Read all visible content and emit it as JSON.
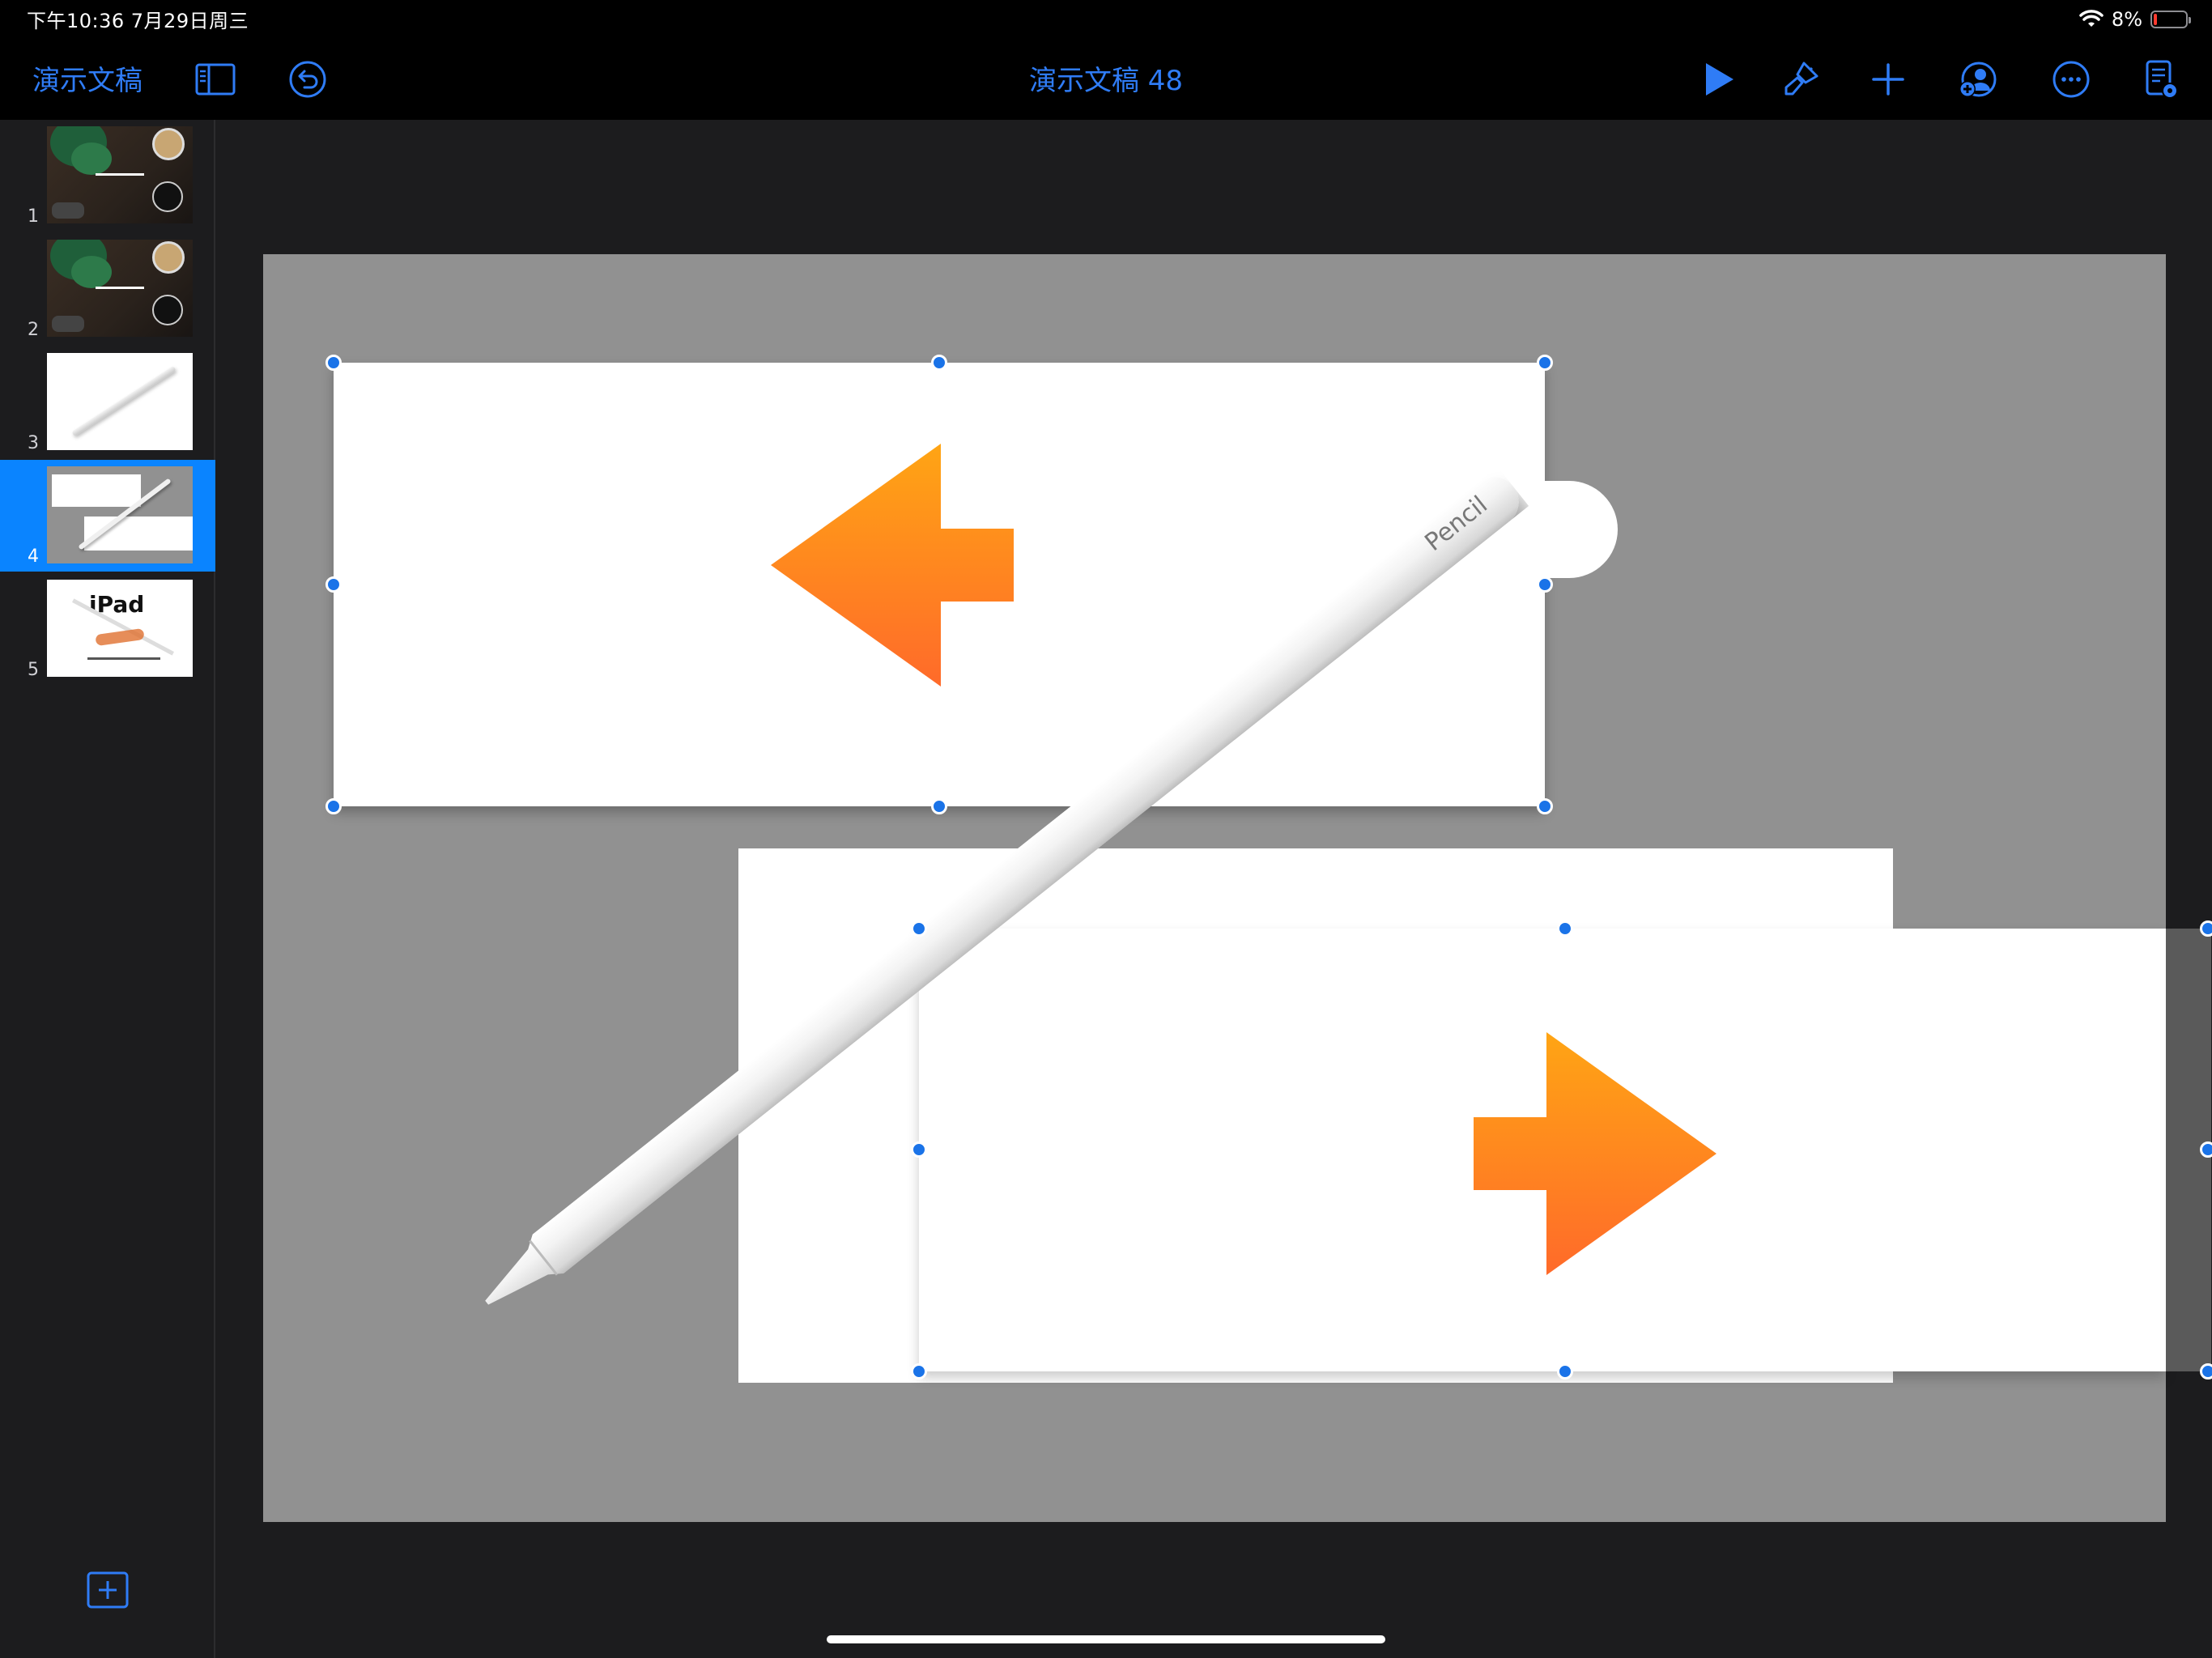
{
  "status_bar": {
    "time": "下午10:36   7月29日周三",
    "battery": "8%",
    "battery_level": 0.08
  },
  "toolbar": {
    "documents_link": "演示文稿",
    "title": "演示文稿 48",
    "icons": [
      "sidebar-icon",
      "undo-icon",
      "play-icon",
      "format-brush-icon",
      "add-icon",
      "collaborate-icon",
      "more-icon",
      "presenter-notes-icon"
    ]
  },
  "sidebar": {
    "slides": [
      {
        "number": "1"
      },
      {
        "number": "2"
      },
      {
        "number": "3"
      },
      {
        "number": "4",
        "selected": true
      },
      {
        "number": "5",
        "thumb_text": "iPad"
      }
    ]
  },
  "canvas": {
    "pencil_label": "Pencil",
    "accent_color": "#ff8a1f",
    "selection_color": "#1a73e8",
    "canvas_color": "#919191"
  }
}
